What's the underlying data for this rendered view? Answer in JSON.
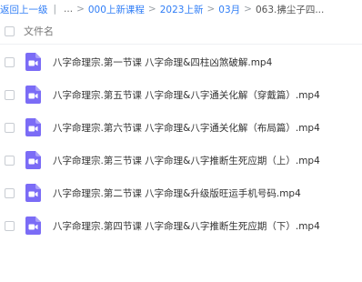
{
  "breadcrumb": {
    "back": "返回上一级",
    "ellipsis": "...",
    "items": [
      "000上新课程",
      "2023上新",
      "03月"
    ],
    "current": "063.拂尘子四...",
    "sep": ">"
  },
  "list_header": {
    "column_label": "文件名"
  },
  "files": [
    {
      "name": "八字命理宗.第一节课 八字命理&四柱凶煞破解.mp4",
      "icon": "video-file-icon"
    },
    {
      "name": "八字命理宗.第五节课 八字命理&八字通关化解（穿戴篇）.mp4",
      "icon": "video-file-icon"
    },
    {
      "name": "八字命理宗.第六节课 八字命理&八字通关化解（布局篇）.mp4",
      "icon": "video-file-icon"
    },
    {
      "name": "八字命理宗.第三节课 八字命理&八字推断生死应期（上）.mp4",
      "icon": "video-file-icon"
    },
    {
      "name": "八字命理宗.第二节课 八字命理&升级版旺运手机号码.mp4",
      "icon": "video-file-icon"
    },
    {
      "name": "八字命理宗.第四节课 八字命理&八字推断生死应期（下）.mp4",
      "icon": "video-file-icon"
    }
  ],
  "colors": {
    "link": "#2f7df6",
    "video_icon": "#7b6cf6"
  }
}
